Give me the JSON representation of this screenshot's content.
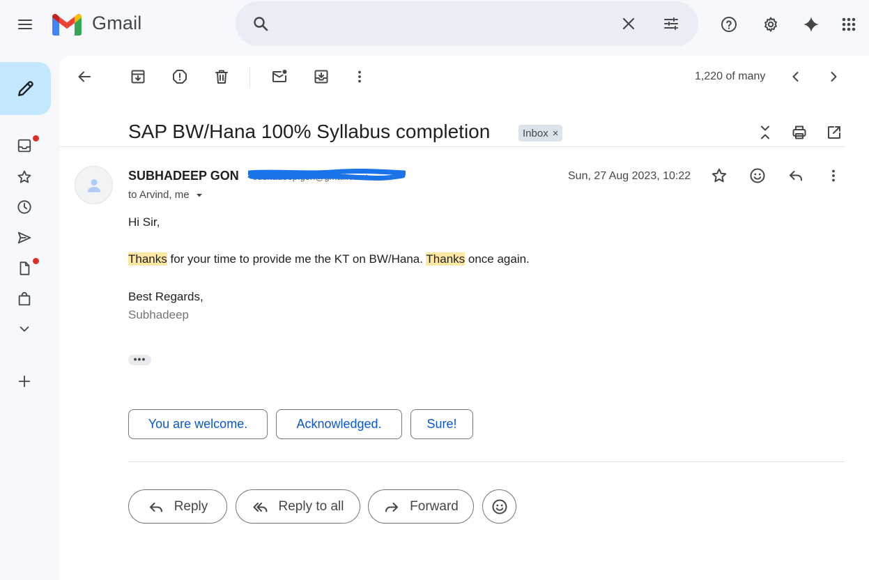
{
  "app": {
    "name": "Gmail"
  },
  "search": {
    "placeholder": ""
  },
  "toolbar": {
    "count": "1,220 of many"
  },
  "message": {
    "subject": "SAP BW/Hana 100% Syllabus completion",
    "label": "Inbox",
    "label_remove": "×",
    "sender_name": "SUBHADEEP GON",
    "sender_email": "<subhadeep.gon@gmail.com>",
    "recipients": "to Arvind, me",
    "date": "Sun, 27 Aug 2023, 10:22",
    "greeting": "Hi Sir,",
    "line_hl1": "Thanks",
    "line_mid": " for your time to provide me the KT on BW/Hana. ",
    "line_hl2": "Thanks",
    "line_end": " once again.",
    "closing": "Best Regards,",
    "signature": "Subhadeep",
    "trimmed": "•••"
  },
  "smart_replies": [
    "You are welcome.",
    "Acknowledged.",
    "Sure!"
  ],
  "actions": {
    "reply": "Reply",
    "reply_all": "Reply to all",
    "forward": "Forward"
  },
  "colors": {
    "accent": "#0b57d0",
    "compose": "#c2e7ff",
    "highlight": "#fde8a3",
    "badge": "#d93025"
  }
}
